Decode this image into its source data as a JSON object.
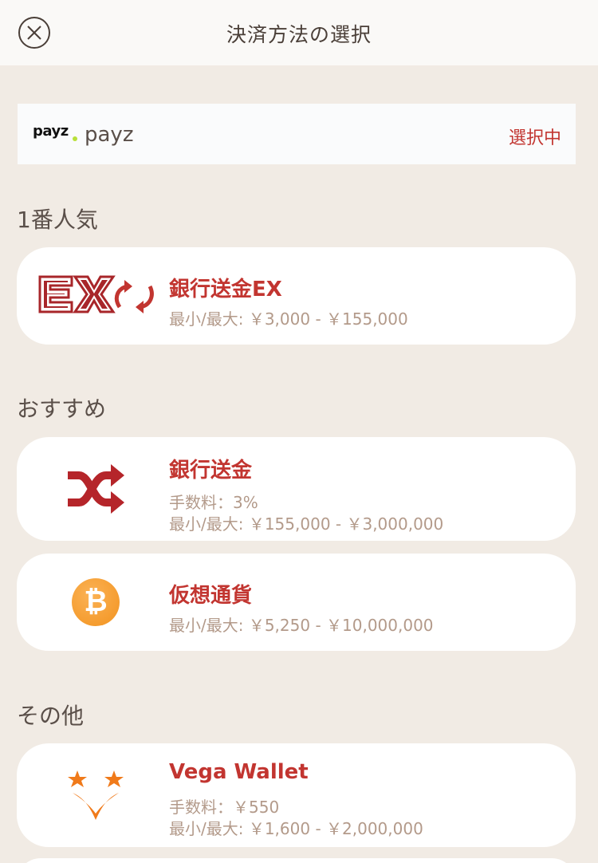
{
  "header": {
    "title": "決済方法の選択"
  },
  "selected": {
    "logo_text": "payz",
    "name": "payz",
    "status": "選択中"
  },
  "sections": [
    {
      "title": "1番人気",
      "items": [
        {
          "name": "銀行送金EX",
          "icon": "bank-transfer-ex-icon",
          "limits": "最小/最大: ￥3,000 - ￥155,000"
        }
      ]
    },
    {
      "title": "おすすめ",
      "items": [
        {
          "name": "銀行送金",
          "icon": "shuffle-icon",
          "fee": "手数料：3%",
          "limits": "最小/最大: ￥155,000 - ￥3,000,000"
        },
        {
          "name": "仮想通貨",
          "icon": "bitcoin-icon",
          "limits": "最小/最大: ￥5,250 - ￥10,000,000"
        }
      ]
    },
    {
      "title": "その他",
      "items": [
        {
          "name": "Vega Wallet",
          "icon": "vega-wallet-icon",
          "fee": "手数料：￥550",
          "limits": "最小/最大: ￥1,600 - ￥2,000,000"
        }
      ]
    }
  ],
  "colors": {
    "background": "#f1ebe4",
    "accent_red": "#c23530",
    "muted_text": "#b39a8a",
    "bitcoin_orange": "#f2931f",
    "vega_orange": "#f07a1a"
  }
}
